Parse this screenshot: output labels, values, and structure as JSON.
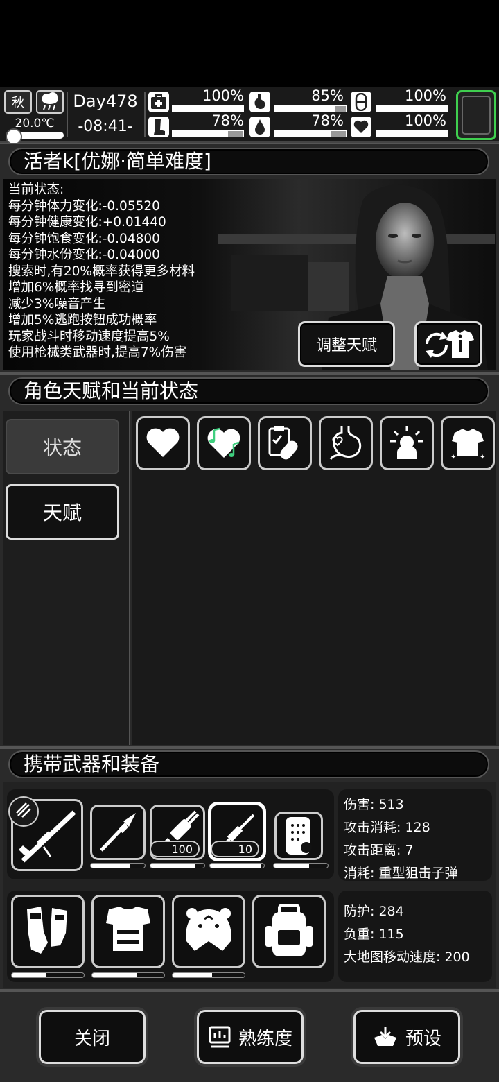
{
  "hud": {
    "season": "秋",
    "temperature": "20.0℃",
    "day": "Day478",
    "time": "-08:41-",
    "stats": [
      {
        "name": "health",
        "icon": "medkit-icon",
        "value": "100%",
        "fill": 1.0
      },
      {
        "name": "stamina",
        "icon": "leg-icon",
        "value": "78%",
        "fill": 0.78
      },
      {
        "name": "hunger",
        "icon": "stomach-icon",
        "value": "85%",
        "fill": 0.85
      },
      {
        "name": "thirst",
        "icon": "water-drop-icon",
        "value": "78%",
        "fill": 0.78
      },
      {
        "name": "mood",
        "icon": "pill-icon",
        "value": "100%",
        "fill": 1.0
      },
      {
        "name": "spirit",
        "icon": "heart-icon",
        "value": "100%",
        "fill": 1.0
      }
    ]
  },
  "character": {
    "title": "活者k[优娜·简单难度]",
    "status_lines": [
      "当前状态:",
      "每分钟体力变化:-0.05520",
      "每分钟健康变化:+0.01440",
      "每分钟饱食变化:-0.04800",
      "每分钟水份变化:-0.04000",
      "搜索时,有20%概率获得更多材料",
      "增加6%概率找寻到密道",
      "减少3%噪音产生",
      "增加5%逃跑按钮成功概率",
      "玩家战斗时移动速度提高5%",
      "使用枪械类武器时,提高7%伤害"
    ],
    "adjust_talent_label": "调整天赋"
  },
  "talents": {
    "title": "角色天赋和当前状态",
    "tabs": [
      "状态",
      "天赋"
    ],
    "status_icons": [
      "heart-icon",
      "music-heart-icon",
      "medicine-icon",
      "stomach-heart-icon",
      "alarm-icon",
      "clothing-icon"
    ]
  },
  "equipment": {
    "title": "携带武器和装备",
    "weapons": [
      {
        "name": "sniper-rifle",
        "durability": 1.0
      },
      {
        "name": "spear",
        "durability": 0.72
      },
      {
        "name": "minigun",
        "ammo": "100",
        "durability": 0.82
      },
      {
        "name": "harpoon-gun",
        "ammo": "10",
        "durability": 0.95
      },
      {
        "name": "riot-shield",
        "durability": 0.66
      }
    ],
    "weapon_stats": {
      "damage": "伤害: 513",
      "attack_cost": "攻击消耗: 128",
      "attack_range": "攻击距离: 7",
      "consumes": "消耗: 重型狙击子弹"
    },
    "armor": [
      {
        "name": "gloves",
        "durability": 0.48
      },
      {
        "name": "body-armor",
        "durability": 0.62
      },
      {
        "name": "tiger-hat",
        "durability": 0.55
      },
      {
        "name": "backpack",
        "durability": 0.0
      }
    ],
    "armor_stats": {
      "defense": "防护: 284",
      "load": "负重: 115",
      "map_speed": "大地图移动速度: 200"
    }
  },
  "footer": {
    "close_label": "关闭",
    "proficiency_label": "熟练度",
    "preset_label": "预设"
  }
}
